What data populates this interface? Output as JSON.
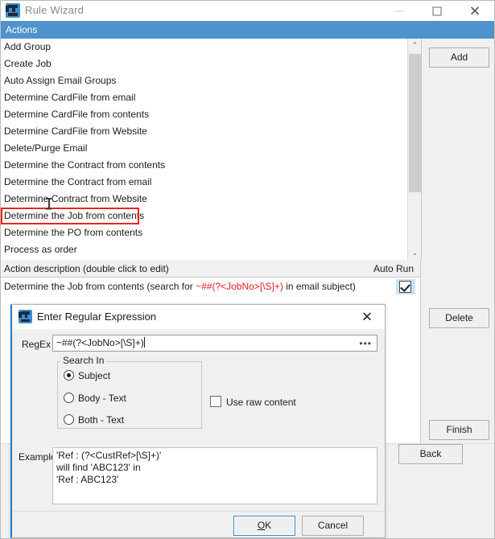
{
  "window": {
    "title": "Rule Wizard",
    "icon": "app-icon",
    "controls": {
      "minimize": "—",
      "maximize": "□",
      "close": "✕"
    }
  },
  "header": {
    "label": "Actions"
  },
  "actions_list": {
    "items": [
      {
        "label": "Add Group",
        "highlighted": false
      },
      {
        "label": "Create Job",
        "highlighted": false
      },
      {
        "label": "Auto Assign Email Groups",
        "highlighted": false
      },
      {
        "label": "Determine CardFile from email",
        "highlighted": false
      },
      {
        "label": "Determine CardFile from contents",
        "highlighted": false
      },
      {
        "label": "Determine CardFile from Website",
        "highlighted": false
      },
      {
        "label": "Delete/Purge Email",
        "highlighted": false
      },
      {
        "label": "Determine the Contract from contents",
        "highlighted": false
      },
      {
        "label": "Determine the Contract from email",
        "highlighted": false
      },
      {
        "label": "Determine Contract from Website",
        "highlighted": false
      },
      {
        "label": "Determine the Job from contents",
        "highlighted": true
      },
      {
        "label": "Determine the PO from contents",
        "highlighted": false
      },
      {
        "label": "Process as order",
        "highlighted": false
      }
    ],
    "highlight_color": "#e8261c",
    "scrollbar": {
      "up": "⌃",
      "down": "⌄"
    }
  },
  "description": {
    "header_left": "Action description (double click to edit)",
    "header_right": "Auto Run",
    "row_prefix": "Determine the Job from contents (search for ",
    "row_regex": "~##(?<JobNo>[\\S]+)",
    "row_suffix": " in email subject)",
    "regex_color": "#e02020",
    "auto_run_checked": true
  },
  "side_buttons": {
    "add": "Add",
    "delete": "Delete",
    "finish": "Finish",
    "back": "Back"
  },
  "dialog": {
    "title": "Enter Regular Expression",
    "close": "✕",
    "regex_label": "RegEx",
    "regex_value": "~##(?<JobNo>[\\S]+)",
    "regex_browse": "•••",
    "search_in": {
      "legend": "Search In",
      "options": [
        {
          "label": "Subject",
          "selected": true
        },
        {
          "label": "Body - Text",
          "selected": false
        },
        {
          "label": "Both - Text",
          "selected": false
        }
      ]
    },
    "use_raw_content": {
      "label": "Use raw content",
      "checked": false
    },
    "examples_label": "Examples",
    "examples_lines": [
      "'Ref : (?<CustRef>[\\S]+)'",
      "will find 'ABC123' in",
      "'Ref : ABC123'"
    ],
    "ok_button": {
      "prefix": "",
      "accel": "O",
      "rest": "K"
    },
    "ok_label": "OK",
    "cancel_label": "Cancel"
  }
}
